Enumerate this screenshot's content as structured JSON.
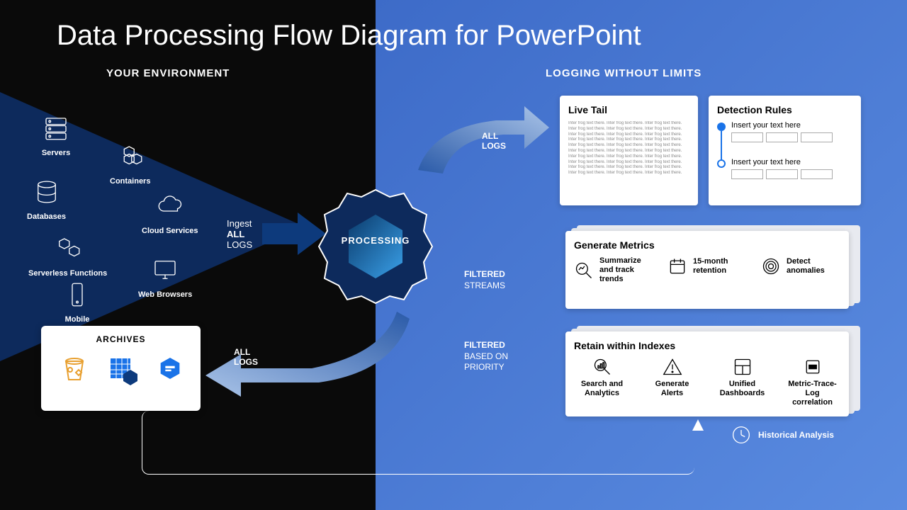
{
  "title": "Data Processing Flow Diagram for PowerPoint",
  "sections": {
    "left": "YOUR ENVIRONMENT",
    "right": "LOGGING WITHOUT LIMITS"
  },
  "env": {
    "servers": "Servers",
    "containers": "Containers",
    "databases": "Databases",
    "cloud": "Cloud Services",
    "serverless": "Serverless Functions",
    "browsers": "Web Browsers",
    "mobile": "Mobile"
  },
  "ingest": {
    "line1": "Ingest",
    "line2": "ALL",
    "line3": "LOGS"
  },
  "processing": "PROCESSING",
  "arrows": {
    "all_logs": "ALL\nLOGS"
  },
  "streams": {
    "filtered_streams": {
      "l1": "FILTERED",
      "l2": "STREAMS"
    },
    "filtered_priority": {
      "l1": "FILTERED",
      "l2": "BASED ON",
      "l3": "PRIORITY"
    }
  },
  "archives": {
    "title": "ARCHIVES"
  },
  "cards": {
    "livetail": {
      "title": "Live Tail"
    },
    "detection": {
      "title": "Detection Rules",
      "placeholder": "Insert your text here"
    },
    "metrics": {
      "title": "Generate Metrics",
      "f1": "Summarize and track trends",
      "f2": "15-month retention",
      "f3": "Detect anomalies"
    },
    "indexes": {
      "title": "Retain within Indexes",
      "f1": "Search and Analytics",
      "f2": "Generate Alerts",
      "f3": "Unified Dashboards",
      "f4": "Metric-Trace-Log correlation"
    }
  },
  "historical": "Historical Analysis"
}
